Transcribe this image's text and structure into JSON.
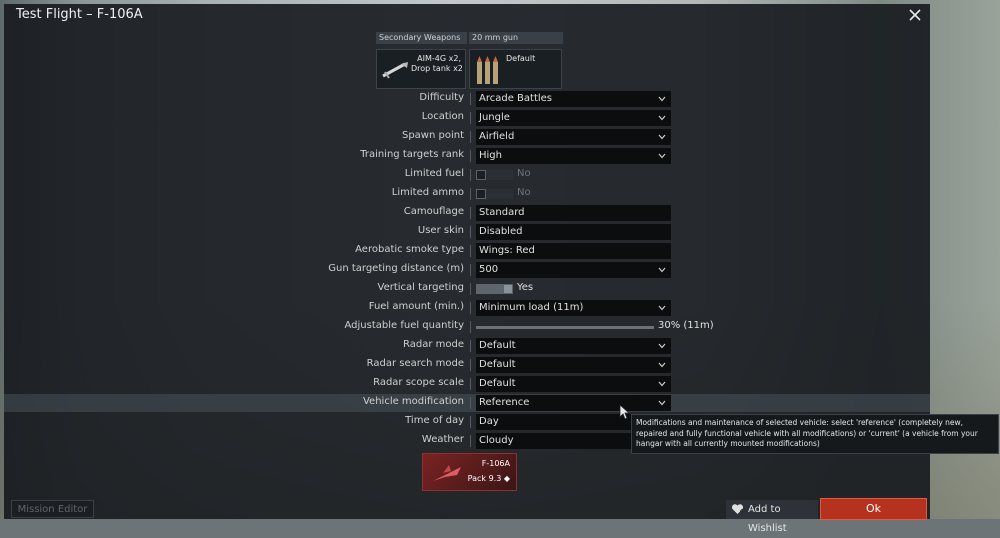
{
  "window": {
    "title": "Test Flight – F-106A"
  },
  "weapons": {
    "tabs": [
      "Secondary Weapons",
      "20 mm gun"
    ],
    "secondary_label": "AIM-4G x2,\nDrop tank x2",
    "gun_label": "Default"
  },
  "rows": [
    {
      "label": "Difficulty",
      "type": "select",
      "value": "Arcade Battles"
    },
    {
      "label": "Location",
      "type": "select",
      "value": "Jungle"
    },
    {
      "label": "Spawn point",
      "type": "select",
      "value": "Airfield"
    },
    {
      "label": "Training targets rank",
      "type": "select",
      "value": "High"
    },
    {
      "label": "Limited fuel",
      "type": "toggle",
      "value": "No",
      "on": false
    },
    {
      "label": "Limited ammo",
      "type": "toggle",
      "value": "No",
      "on": false
    },
    {
      "label": "Camouflage",
      "type": "text",
      "value": "Standard"
    },
    {
      "label": "User skin",
      "type": "text",
      "value": "Disabled"
    },
    {
      "label": "Aerobatic smoke type",
      "type": "text",
      "value": "Wings: Red"
    },
    {
      "label": "Gun targeting distance (m)",
      "type": "select",
      "value": "500"
    },
    {
      "label": "Vertical targeting",
      "type": "toggle",
      "value": "Yes",
      "on": true
    },
    {
      "label": "Fuel amount (min.)",
      "type": "select",
      "value": "Minimum load (11m)"
    },
    {
      "label": "Adjustable fuel quantity",
      "type": "slider",
      "value": "30% (11m)",
      "fraction": 0.3
    },
    {
      "label": "Radar mode",
      "type": "select",
      "value": "Default"
    },
    {
      "label": "Radar search mode",
      "type": "select",
      "value": "Default"
    },
    {
      "label": "Radar scope scale",
      "type": "select",
      "value": "Default"
    },
    {
      "label": "Vehicle modification",
      "type": "select",
      "value": "Reference",
      "highlight": true
    },
    {
      "label": "Time of day",
      "type": "text",
      "value": "Day"
    },
    {
      "label": "Weather",
      "type": "text",
      "value": "Cloudy"
    }
  ],
  "tooltip": "Modifications and maintenance of selected vehicle: select 'reference' (completely new, repaired and fully functional vehicle with all modifications) or 'current' (a vehicle from your hangar with all currently mounted modifications)",
  "vehicle": {
    "name": "F-106A",
    "pack": "Pack 9.3 ◆"
  },
  "footer": {
    "mission_editor": "Mission Editor",
    "wishlist": "Add to Wishlist",
    "ok": "Ok"
  },
  "colors": {
    "accent": "#b5321f",
    "panel": "#16191d"
  }
}
